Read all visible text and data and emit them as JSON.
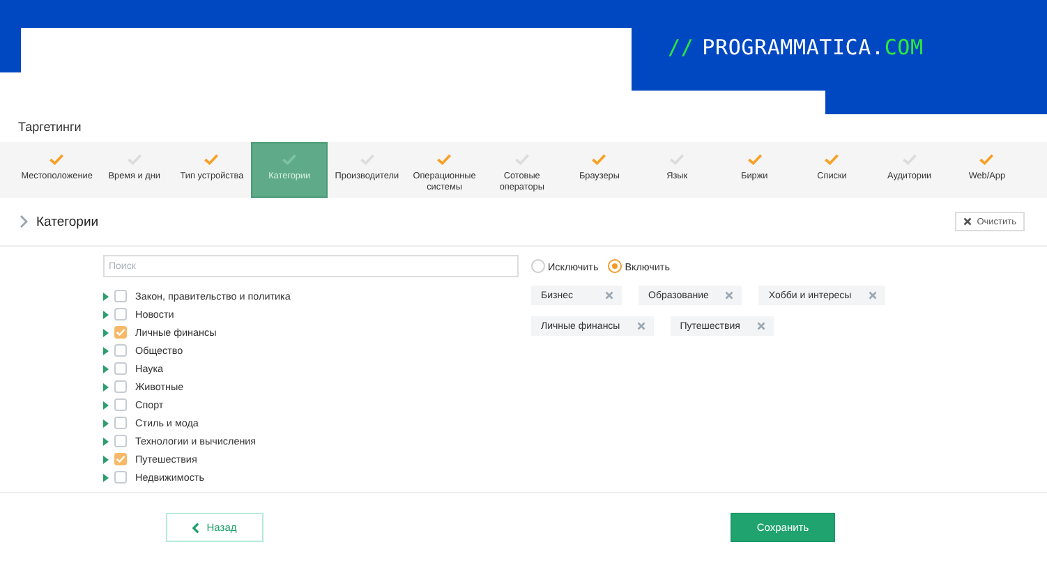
{
  "logo": {
    "slashes": "//",
    "name": "PROGRAMMATICA.",
    "suffix": "COM"
  },
  "page_title": "Таргетинги",
  "steps": [
    {
      "label": "Местоположение",
      "done": true,
      "selected": false
    },
    {
      "label": "Время и дни",
      "done": false,
      "selected": false
    },
    {
      "label": "Тип устройства",
      "done": true,
      "selected": false
    },
    {
      "label": "Категории",
      "done": false,
      "selected": true
    },
    {
      "label": "Производители",
      "done": false,
      "selected": false
    },
    {
      "label": "Операционные системы",
      "done": true,
      "selected": false
    },
    {
      "label": "Сотовые операторы",
      "done": false,
      "selected": false
    },
    {
      "label": "Браузеры",
      "done": true,
      "selected": false
    },
    {
      "label": "Язык",
      "done": false,
      "selected": false
    },
    {
      "label": "Биржи",
      "done": true,
      "selected": false
    },
    {
      "label": "Списки",
      "done": true,
      "selected": false
    },
    {
      "label": "Аудитории",
      "done": false,
      "selected": false
    },
    {
      "label": "Web/App",
      "done": true,
      "selected": false
    }
  ],
  "section": {
    "title": "Категории",
    "expanded": false,
    "clear_button": "Очистить"
  },
  "search": {
    "placeholder": "Поиск"
  },
  "categories": [
    {
      "label": "Закон, правительство и политика",
      "checked": false
    },
    {
      "label": "Новости",
      "checked": false
    },
    {
      "label": "Личные финансы",
      "checked": true
    },
    {
      "label": "Общество",
      "checked": false
    },
    {
      "label": "Наука",
      "checked": false
    },
    {
      "label": "Животные",
      "checked": false
    },
    {
      "label": "Спорт",
      "checked": false
    },
    {
      "label": "Стиль и мода",
      "checked": false
    },
    {
      "label": "Технологии и вычисления",
      "checked": false
    },
    {
      "label": "Путешествия",
      "checked": true
    },
    {
      "label": "Недвижимость",
      "checked": false
    }
  ],
  "mode": [
    {
      "label": "Исключить",
      "selected": false
    },
    {
      "label": "Включить",
      "selected": true
    }
  ],
  "tags": [
    [
      "Бизнес",
      "Образование",
      "Хобби и интересы"
    ],
    [
      "Личные финансы",
      "Путешествия"
    ]
  ],
  "buttons": {
    "back": "Назад",
    "save": "Сохранить"
  }
}
